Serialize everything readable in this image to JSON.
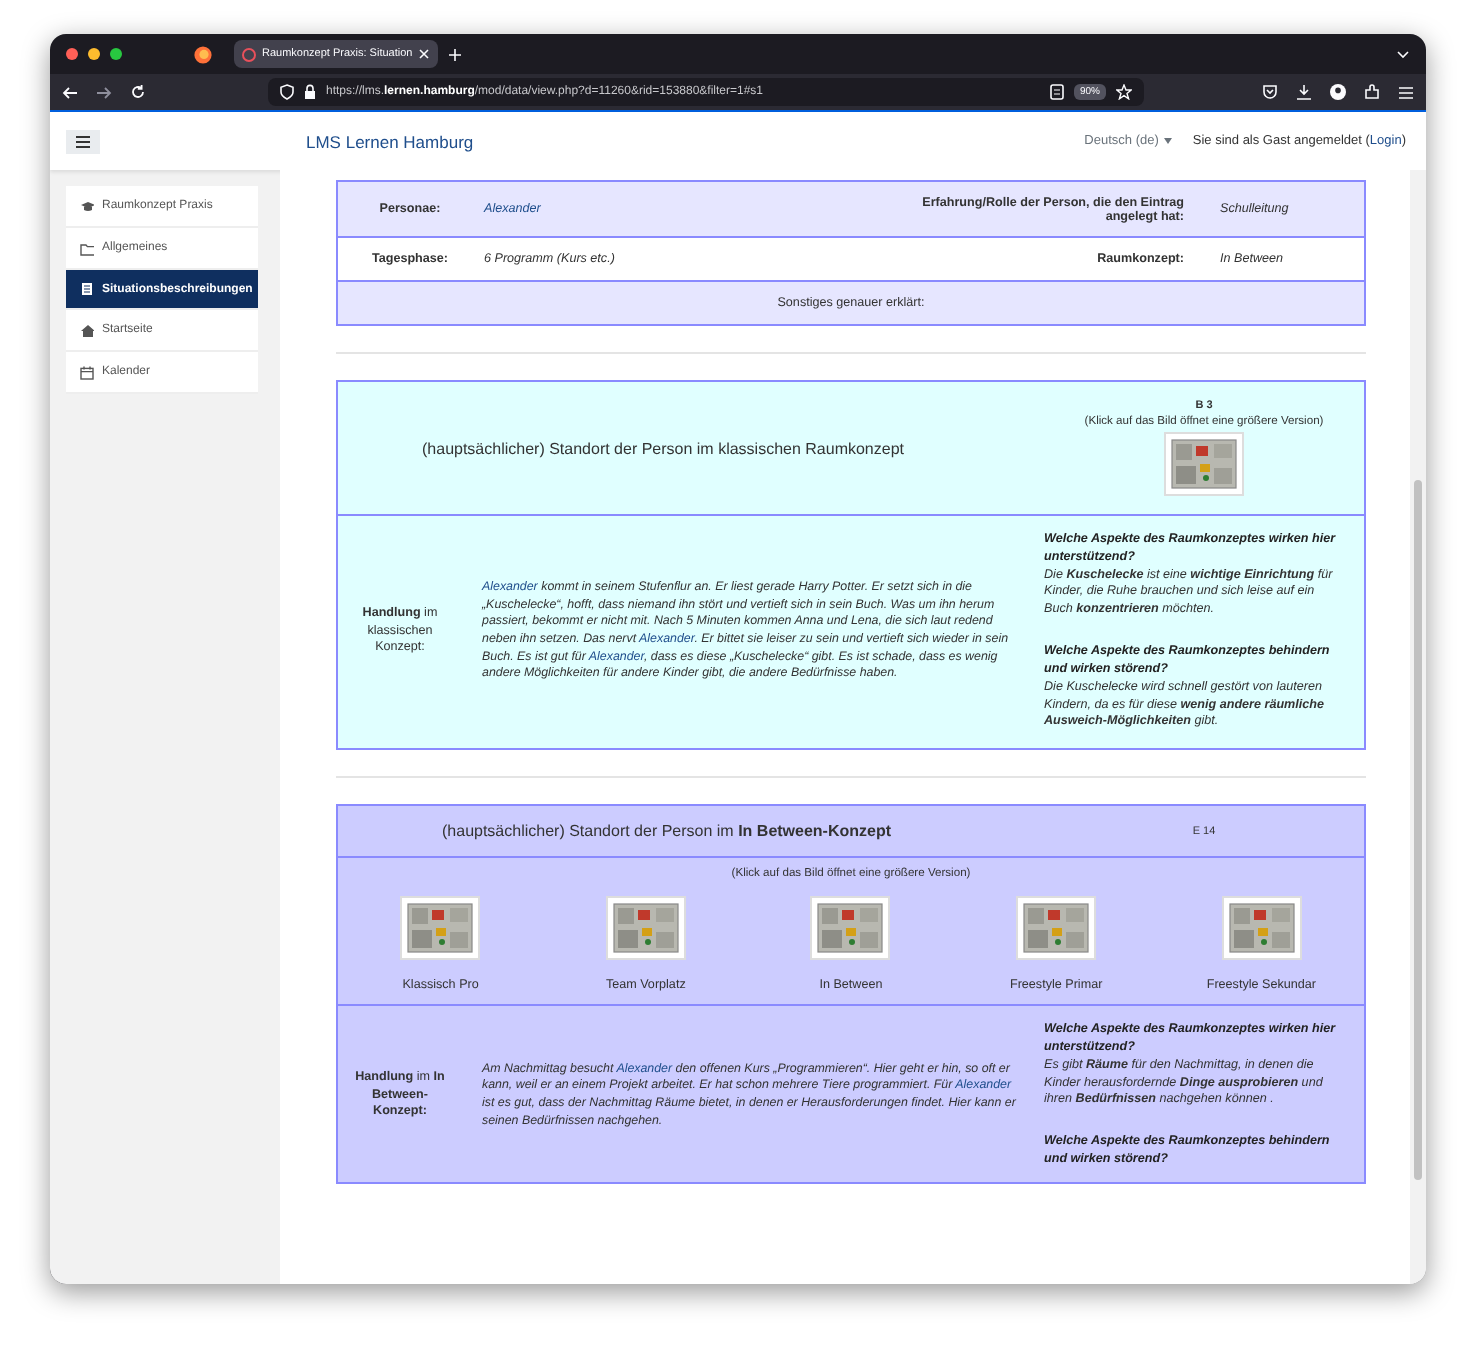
{
  "browser": {
    "tab_title": "Raumkonzept Praxis: Situation",
    "url": "https://lms.**lernen.hamburg**/mod/data/view.php?d=11260&rid=153880&filter=1#s1",
    "zoom": "90%"
  },
  "header": {
    "site_name": "LMS Lernen Hamburg",
    "language": "Deutsch (de)",
    "login": [
      {
        "kind": "text",
        "text": "Sie sind als Gast angemeldet ("
      },
      {
        "kind": "link",
        "text": "Login"
      },
      {
        "kind": "text",
        "text": ")"
      }
    ]
  },
  "sidebar": {
    "items": [
      {
        "label": "Raumkonzept Praxis",
        "kind": "course",
        "selected": false
      },
      {
        "label": "Allgemeines",
        "kind": "section",
        "selected": false
      },
      {
        "label": "Situationsbeschreibungen",
        "kind": "database",
        "selected": true
      },
      {
        "label": "Startseite",
        "kind": "home",
        "selected": false
      },
      {
        "label": "Kalender",
        "kind": "calendar",
        "selected": false
      }
    ]
  },
  "entry_info": {
    "rows": [
      {
        "cells": [
          {
            "kind": "label",
            "text": "Personae:"
          },
          {
            "kind": "link",
            "text": "Alexander"
          },
          {
            "kind": "label",
            "text": "Erfahrung/Rolle der Person, die den Eintrag angelegt hat:"
          },
          {
            "kind": "value",
            "text": "Schulleitung"
          }
        ]
      },
      {
        "cells": [
          {
            "kind": "label",
            "text": "Tagesphase:"
          },
          {
            "kind": "value",
            "text": "6 Programm (Kurs etc.)"
          },
          {
            "kind": "label",
            "text": "Raumkonzept:"
          },
          {
            "kind": "value",
            "text": "In Between"
          }
        ]
      },
      {
        "cells": [
          {
            "kind": "note",
            "text": "Sonstiges genauer erklärt:"
          }
        ]
      }
    ]
  },
  "classic_section": {
    "heading": "(hauptsächlicher) Standort der Person im klassischen Raumkonzept",
    "plan_code": "B 3",
    "image_hint": "(Klick auf das Bild öffnet eine größere Version)",
    "action_label": "**Handlung** im klassischen Konzept:",
    "action_text": [
      {
        "kind": "link",
        "text": "Alexander"
      },
      {
        "kind": "text",
        "text": " kommt in seinem Stufenflur an. Er liest gerade Harry Potter. Er setzt sich in die „Kuschelecke“, hofft, dass niemand ihn stört und vertieft sich in sein Buch. Was um ihn herum passiert, bekommt er nicht mit. Nach 5 Minuten kommen Anna und Lena, die sich laut redend neben ihn setzen. Das nervt "
      },
      {
        "kind": "link",
        "text": "Alexander"
      },
      {
        "kind": "text",
        "text": ". Er bittet sie leiser zu sein und vertieft sich wieder in sein Buch. Es ist gut für "
      },
      {
        "kind": "link",
        "text": "Alexander"
      },
      {
        "kind": "text",
        "text": ", dass es diese „Kuschelecke“ gibt. Es ist schade, dass es wenig andere Möglichkeiten für andere Kinder gibt, die andere Bedürfnisse haben."
      }
    ],
    "aspects": [
      {
        "question": "Welche Aspekte des Raumkonzeptes wirken hier unterstützend?",
        "answer": "Die **Kuschelecke** ist eine **wichtige Einrichtung** für Kinder, die Ruhe brauchen und sich leise auf ein Buch **konzentrieren** möchten."
      },
      {
        "question": "Welche Aspekte des Raumkonzeptes behindern und wirken störend?",
        "answer": "Die Kuschelecke wird schnell gestört von lauteren Kindern, da es für diese **wenig andere räumliche Ausweich-Möglichkeiten** gibt."
      }
    ]
  },
  "inbetween_section": {
    "heading": "(hauptsächlicher) Standort der Person im **In Between-Konzept**",
    "plan_code": "E 14",
    "image_hint": "(Klick auf das Bild öffnet eine größere Version)",
    "plans": [
      {
        "label": "Klassisch Pro"
      },
      {
        "label": "Team Vorplatz"
      },
      {
        "label": "In Between"
      },
      {
        "label": "Freestyle Primar"
      },
      {
        "label": "Freestyle Sekundar"
      }
    ],
    "action_label": "**Handlung** im **In Between-Konzept:**",
    "action_text": [
      {
        "kind": "text",
        "text": "Am Nachmittag besucht "
      },
      {
        "kind": "link",
        "text": "Alexander"
      },
      {
        "kind": "text",
        "text": " den offenen Kurs „Programmieren“. Hier geht er hin, so oft er kann, weil er an einem Projekt arbeitet. Er hat schon mehrere Tiere programmiert. Für "
      },
      {
        "kind": "link",
        "text": "Alexander"
      },
      {
        "kind": "text",
        "text": " ist es gut, dass der Nachmittag Räume bietet, in denen er Herausforderungen findet. Hier kann er seinen Bedürfnissen nachgehen."
      }
    ],
    "aspects": [
      {
        "question": "Welche Aspekte des Raumkonzeptes wirken hier unterstützend?",
        "answer": "Es gibt **Räume** für den Nachmittag, in denen die Kinder herausfordernde **Dinge ausprobieren** und ihren **Bedürfnissen** nachgehen können ."
      },
      {
        "question": "Welche Aspekte des Raumkonzeptes behindern und wirken störend?"
      }
    ]
  }
}
